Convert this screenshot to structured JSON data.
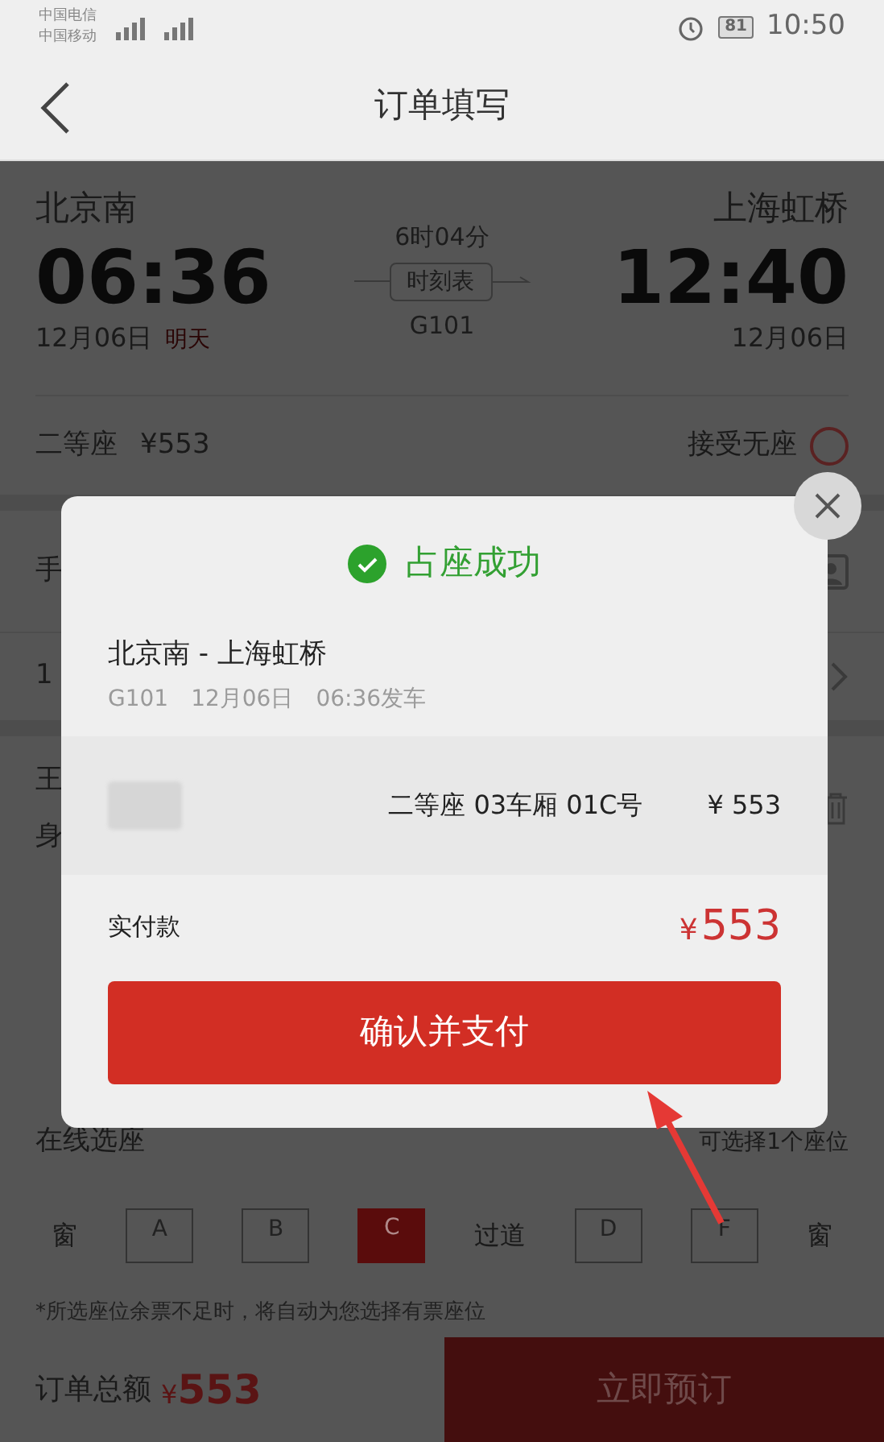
{
  "status_bar": {
    "carriers": [
      "中国电信",
      "中国移动"
    ],
    "battery": "81",
    "time": "10:50"
  },
  "header": {
    "title": "订单填写"
  },
  "train": {
    "from": "北京南",
    "to": "上海虹桥",
    "depart_time": "06:36",
    "arrive_time": "12:40",
    "depart_date": "12月06日",
    "next_day": "明天",
    "arrive_date": "12月06日",
    "duration": "6时04分",
    "timetable_button": "时刻表",
    "train_no": "G101"
  },
  "seat_class": {
    "label": "二等座",
    "price": "¥553",
    "accept_no_seat": {
      "label": "接受无座",
      "checked": false
    }
  },
  "covered_rows": {
    "contact": "手",
    "date": "1",
    "passenger_name": "王",
    "passenger_id": "身"
  },
  "seat_selection": {
    "title": "在线选座",
    "hint": "可选择1个座位",
    "seats": [
      {
        "kind": "label",
        "text": "窗"
      },
      {
        "kind": "seat",
        "text": "A",
        "selected": false
      },
      {
        "kind": "seat",
        "text": "B",
        "selected": false
      },
      {
        "kind": "seat",
        "text": "C",
        "selected": true
      },
      {
        "kind": "label",
        "text": "过道"
      },
      {
        "kind": "seat",
        "text": "D",
        "selected": false
      },
      {
        "kind": "seat",
        "text": "F",
        "selected": false
      },
      {
        "kind": "label",
        "text": "窗"
      }
    ],
    "note": "*所选座位余票不足时，将自动为您选择有票座位"
  },
  "bottom_bar": {
    "total_label": "订单总额",
    "currency": "¥",
    "total": "553",
    "book_button": "立即预订"
  },
  "dialog": {
    "title": "占座成功",
    "route": "北京南 - 上海虹桥",
    "details": [
      "G101",
      "12月06日",
      "06:36发车"
    ],
    "ticket": {
      "seat": "二等座 03车厢 01C号",
      "price": "¥ 553"
    },
    "paid_label": "实付款",
    "paid_currency": "¥",
    "paid_amount": "553",
    "confirm_button": "确认并支付"
  }
}
